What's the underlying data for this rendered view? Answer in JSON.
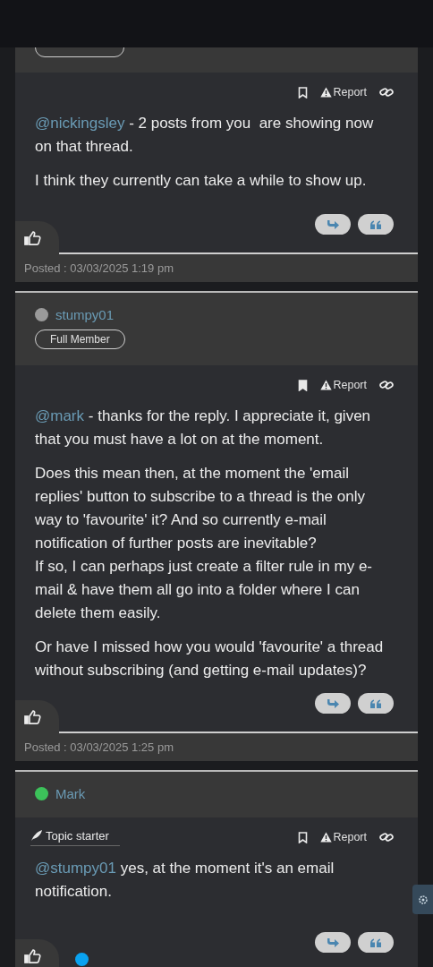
{
  "posts": [
    {
      "header": {
        "kind": "cropped"
      },
      "topic_starter": false,
      "bookmarked": false,
      "report": "Report",
      "paragraphs": [
        [
          {
            "kind": "mention",
            "text": "@nickingsley"
          },
          {
            "kind": "plain",
            "text": " - 2 posts from you  are showing now on that thread."
          }
        ],
        [
          {
            "kind": "plain",
            "text": "I think they currently can take a while to show up."
          }
        ]
      ],
      "posted": "Posted : 03/03/2025 1:19 pm"
    },
    {
      "header": {
        "kind": "user",
        "user": "stumpy01",
        "color": "#9a9a9a",
        "badge": "Full Member"
      },
      "topic_starter": false,
      "bookmarked": true,
      "report": "Report",
      "paragraphs": [
        [
          {
            "kind": "mention",
            "text": "@mark"
          },
          {
            "kind": "plain",
            "text": " - thanks for the reply. I appreciate it, given that you must have a lot on at the moment."
          }
        ],
        [
          {
            "kind": "plain",
            "text": "Does this mean then, at the moment the 'email replies' button to subscribe to a thread is the only way to 'favourite' it? And so currently e-mail notification of further posts are inevitable?\nIf so, I can perhaps just create a filter rule in my e-mail & have them all go into a folder where I can delete them easily."
          }
        ],
        [
          {
            "kind": "plain",
            "text": "Or have I missed how you would 'favourite' a thread without subscribing (and getting e-mail updates)?"
          }
        ]
      ],
      "posted": "Posted : 03/03/2025 1:25 pm"
    },
    {
      "header": {
        "kind": "user",
        "user": "Mark",
        "color": "#3cc25a"
      },
      "topic_starter": true,
      "topic_label": "Topic starter",
      "bookmarked": false,
      "report": "Report",
      "paragraphs": [
        [
          {
            "kind": "mention",
            "text": "@stumpy01"
          },
          {
            "kind": "plain",
            "text": " yes, at the moment it's an email notification."
          }
        ]
      ]
    }
  ]
}
